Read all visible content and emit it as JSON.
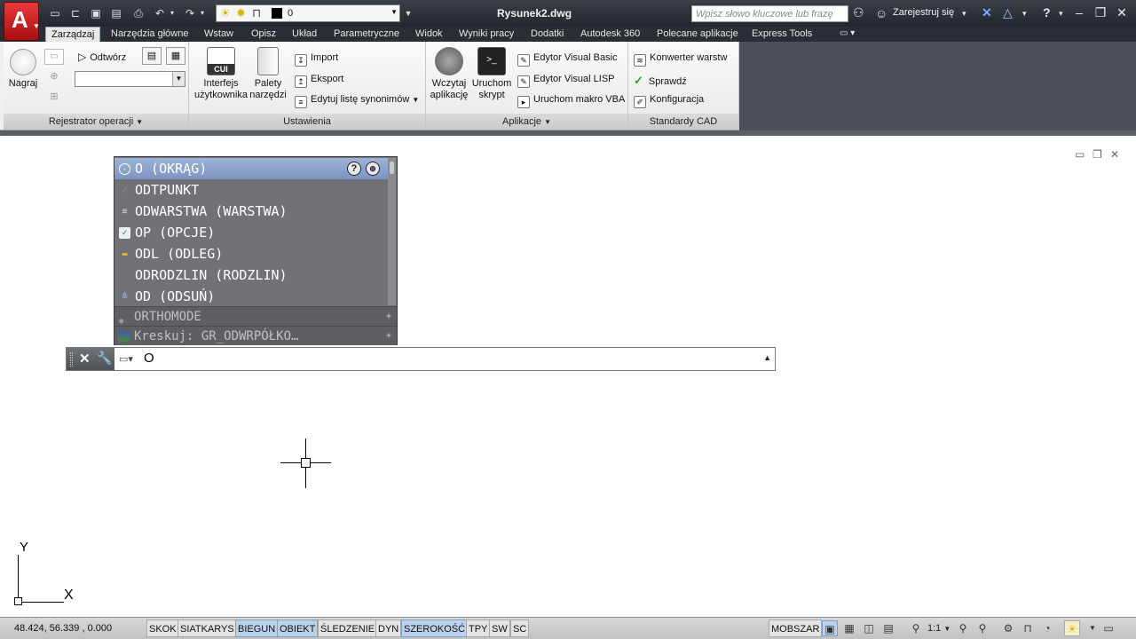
{
  "titlebar": {
    "document_title": "Rysunek2.dwg",
    "workspace_layer_value": "0",
    "search_placeholder": "Wpisz słowo kluczowe lub frazę",
    "signin_label": "Zarejestruj się"
  },
  "tabs": [
    {
      "label": "Zarządzaj",
      "active": true
    },
    {
      "label": "Narzędzia główne"
    },
    {
      "label": "Wstaw"
    },
    {
      "label": "Opisz"
    },
    {
      "label": "Układ"
    },
    {
      "label": "Parametryczne"
    },
    {
      "label": "Widok"
    },
    {
      "label": "Wyniki pracy"
    },
    {
      "label": "Dodatki"
    },
    {
      "label": "Autodesk 360"
    },
    {
      "label": "Polecane aplikacje"
    },
    {
      "label": "Express Tools"
    }
  ],
  "ribbon": {
    "panels": {
      "action_recorder": "Rejestrator operacji",
      "settings": "Ustawienia",
      "applications": "Aplikacje",
      "cad_standards": "Standardy CAD"
    },
    "record_label": "Nagraj",
    "play_label": "Odtwórz",
    "cui_label_1": "Interfejs",
    "cui_label_2": "użytkownika",
    "cui_badge": "CUI",
    "palettes_label_1": "Palety",
    "palettes_label_2": "narzędzi",
    "import_label": "Import",
    "export_label": "Eksport",
    "edit_aliases_label": "Edytuj listę synonimów",
    "load_app_label_1": "Wczytaj",
    "load_app_label_2": "aplikację",
    "run_script_label_1": "Uruchom",
    "run_script_label_2": "skrypt",
    "vba_editor_label": "Edytor Visual Basic",
    "lisp_editor_label": "Edytor Visual LISP",
    "run_vba_label": "Uruchom makro VBA",
    "layer_translator_label": "Konwerter  warstw",
    "check_label": "Sprawdź",
    "configure_label": "Konfiguracja"
  },
  "autocomplete": {
    "items": [
      {
        "label": "O (OKRĄG)",
        "selected": true
      },
      {
        "label": "ODTPUNKT"
      },
      {
        "label": "ODWARSTWA (WARSTWA)"
      },
      {
        "label": "OP (OPCJE)"
      },
      {
        "label": "ODL (ODLEG)"
      },
      {
        "label": "ODRODZLIN (RODZLIN)"
      },
      {
        "label": "OD (ODSUŃ)"
      }
    ],
    "groups": [
      {
        "label": "ORTHOMODE"
      },
      {
        "label": "Kreskuj:  GR_ODWRPÓŁKO…"
      }
    ],
    "help_glyph": "?"
  },
  "command_line": {
    "input_value": "O"
  },
  "ucs": {
    "x_label": "X",
    "y_label": "Y"
  },
  "statusbar": {
    "coords": "48.424, 56.339 , 0.000",
    "toggles": [
      {
        "label": "SKOK",
        "on": false
      },
      {
        "label": "SIATKARYS",
        "on": false
      },
      {
        "label": "BIEGUN",
        "on": true
      },
      {
        "label": "OBIEKT",
        "on": true
      },
      {
        "label": "ŚLEDZENIE",
        "on": false
      },
      {
        "label": "DYN",
        "on": false
      },
      {
        "label": "SZEROKOŚĆ",
        "on": true
      },
      {
        "label": "TPY",
        "on": false
      },
      {
        "label": "SW",
        "on": false
      },
      {
        "label": "SC",
        "on": false
      }
    ],
    "model_label": "MOBSZAR",
    "scale_label": "1:1"
  },
  "colors": {
    "app_red": "#c8161d",
    "selected_row": "#8da4cc",
    "list_bg": "#707276"
  }
}
